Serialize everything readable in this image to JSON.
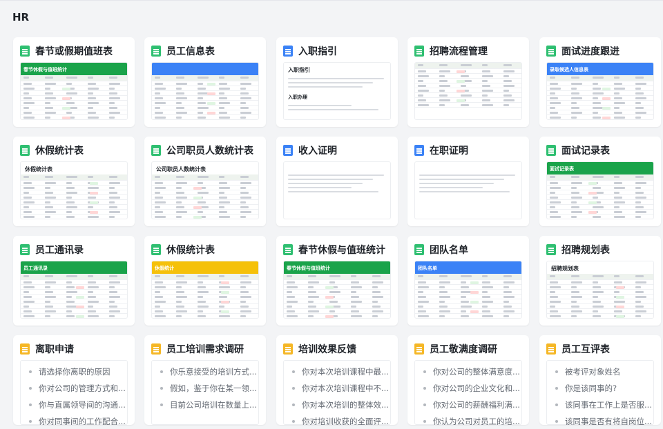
{
  "section": {
    "title": "HR"
  },
  "colors": {
    "sheet": "#2fbf71",
    "doc": "#3b82f6",
    "form": "#f5b726"
  },
  "cards": [
    {
      "title": "春节或假期值班表",
      "type": "sheet",
      "thumb_title": "春节休假与值班统计",
      "bar": "#1aa34a"
    },
    {
      "title": "员工信息表",
      "type": "sheet",
      "thumb_title": "",
      "bar": "#3b82f6"
    },
    {
      "title": "入职指引",
      "type": "doc",
      "thumb_title": "入职指引",
      "doc_sub": "入职办理"
    },
    {
      "title": "招聘流程管理",
      "type": "sheet",
      "thumb_title": "",
      "bar": ""
    },
    {
      "title": "面试进度跟进",
      "type": "sheet",
      "thumb_title": "录取候选人信息表",
      "bar": "#3b82f6"
    },
    {
      "title": "休假统计表",
      "type": "sheet",
      "thumb_title": "休假统计表",
      "bar": ""
    },
    {
      "title": "公司职员人数统计表",
      "type": "sheet",
      "thumb_title": "公司职员人数统计表",
      "bar": ""
    },
    {
      "title": "收入证明",
      "type": "doc",
      "thumb_title": "",
      "doc_sub": ""
    },
    {
      "title": "在职证明",
      "type": "doc",
      "thumb_title": "",
      "doc_sub": ""
    },
    {
      "title": "面试记录表",
      "type": "sheet",
      "thumb_title": "面试记录表",
      "bar": "#1aa34a"
    },
    {
      "title": "员工通讯录",
      "type": "sheet",
      "thumb_title": "员工通讯录",
      "bar": "#1aa34a"
    },
    {
      "title": "休假统计表",
      "type": "sheet",
      "thumb_title": "休假统计",
      "bar": "#f5c10a"
    },
    {
      "title": "春节休假与值班统计",
      "type": "sheet",
      "thumb_title": "春节休假与值班统计",
      "bar": "#1aa34a"
    },
    {
      "title": "团队名单",
      "type": "sheet",
      "thumb_title": "团队名单",
      "bar": "#3b82f6"
    },
    {
      "title": "招聘规划表",
      "type": "sheet",
      "thumb_title": "招聘规划表",
      "bar": ""
    }
  ],
  "forms": [
    {
      "title": "离职申请",
      "items": [
        "请选择你离职的原因",
        "你对公司的管理方式和...",
        "你与直属领导间的沟通...",
        "你对同事间的工作配合..."
      ]
    },
    {
      "title": "员工培训需求调研",
      "items": [
        "你乐意接受的培训方式...",
        "假如，鉴于你在某一领...",
        "目前公司培训在数量上..."
      ]
    },
    {
      "title": "培训效果反馈",
      "items": [
        "你对本次培训课程中最...",
        "你对本次培训课程中不...",
        "你对本次培训的整体效...",
        "你对培训收获的全面评..."
      ]
    },
    {
      "title": "员工敬满度调研",
      "items": [
        "你对公司的整体满意度...",
        "你对公司的企业文化和...",
        "你对公司的薪酬福利满...",
        "你认为公司对员工的培..."
      ]
    },
    {
      "title": "员工互评表",
      "items": [
        "被考评对象姓名",
        "你是该同事的?",
        "该同事在工作上是否服...",
        "该同事是否有将自岗位..."
      ]
    }
  ]
}
